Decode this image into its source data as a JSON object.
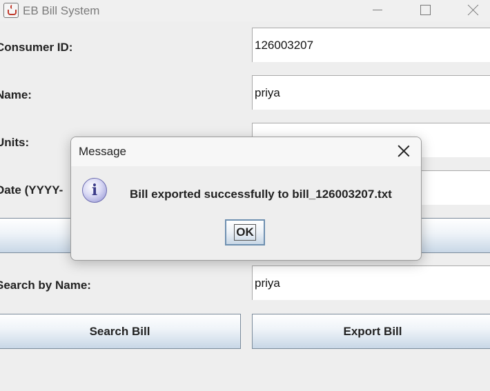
{
  "window": {
    "title": "EB Bill System",
    "minimize_icon": "minimize-icon",
    "maximize_icon": "maximize-icon",
    "close_icon": "close-icon"
  },
  "form": {
    "consumer_id_label": "Consumer ID:",
    "consumer_id_value": "126003207",
    "name_label": "Name:",
    "name_value": "priya",
    "units_label": "Units:",
    "units_value": "",
    "date_label": "Date (YYYY-",
    "date_value": "",
    "search_label": "Search by Name:",
    "search_value": "priya",
    "search_button": "Search Bill",
    "export_button": "Export Bill"
  },
  "dialog": {
    "title": "Message",
    "icon": "information-icon",
    "icon_glyph": "i",
    "message": "Bill exported successfully to bill_126003207.txt",
    "ok_button": "OK"
  }
}
